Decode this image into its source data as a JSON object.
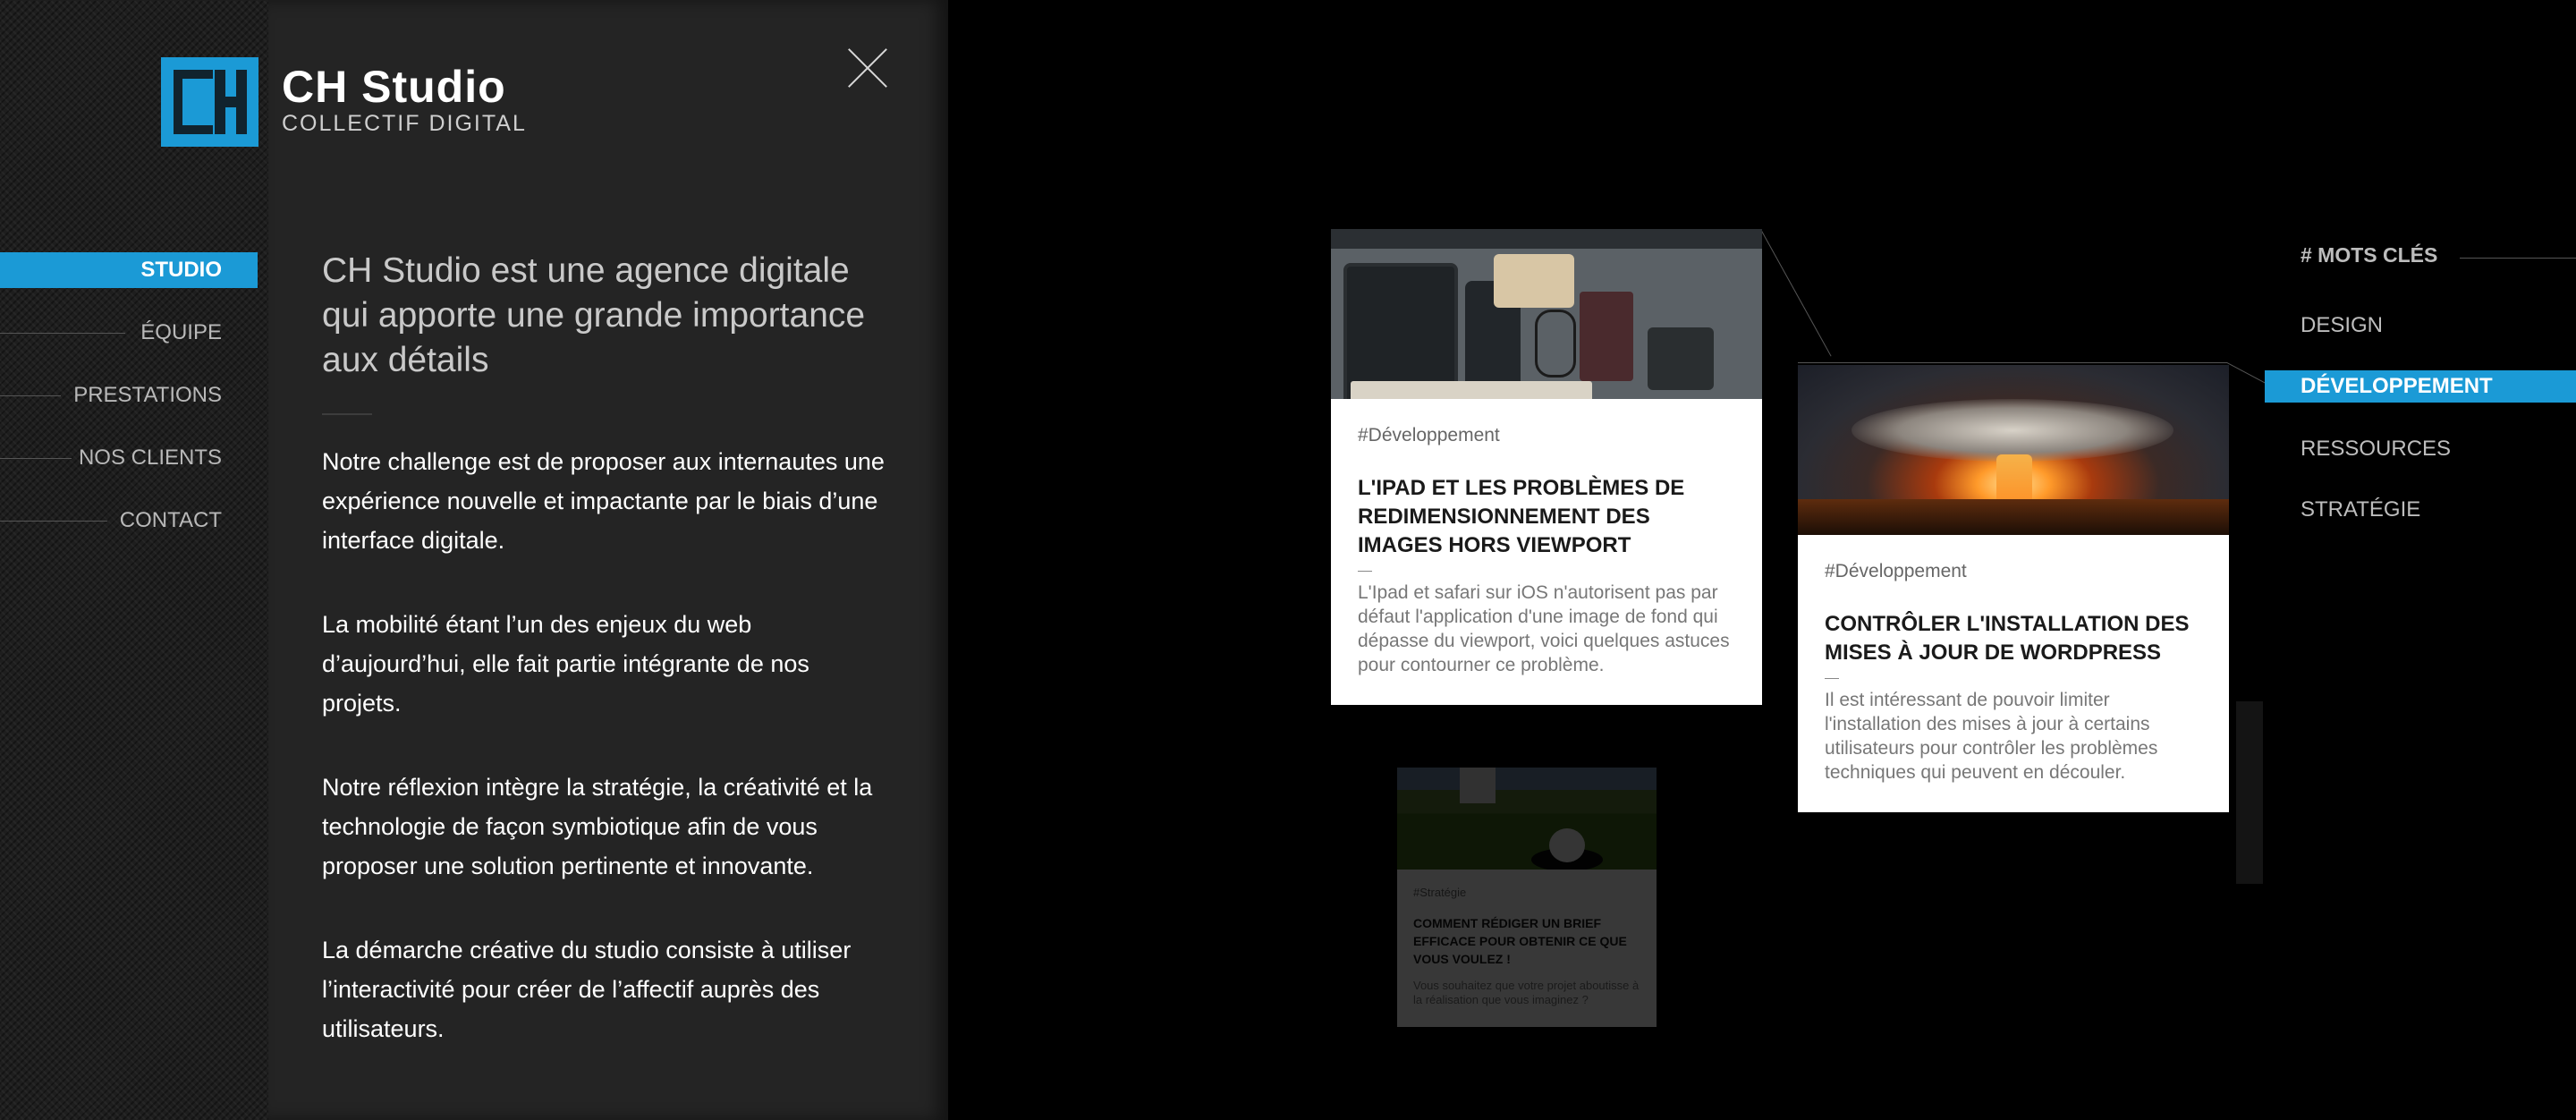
{
  "brand": {
    "name": "CH Studio",
    "tagline": "COLLECTIF DIGITAL"
  },
  "left_nav": [
    {
      "label": "STUDIO",
      "active": true
    },
    {
      "label": "ÉQUIPE",
      "active": false
    },
    {
      "label": "PRESTATIONS",
      "active": false
    },
    {
      "label": "NOS CLIENTS",
      "active": false
    },
    {
      "label": "CONTACT",
      "active": false
    }
  ],
  "panel": {
    "intro": "CH Studio est une agence digitale qui apporte une grande importance aux détails",
    "paragraphs": [
      "Notre challenge est de proposer aux internautes une expérience nouvelle et impactante par le biais d’une interface digitale.",
      "La mobilité étant l’un des enjeux du web d’aujourd’hui, elle fait partie intégrante de nos projets.",
      "Notre réflexion intègre la stratégie, la créativité et la technologie de façon symbiotique afin de vous proposer une solution pertinente et innovante.",
      "La démarche créative du studio consiste à utiliser l’interactivité pour créer de l’affectif auprès des utilisateurs."
    ]
  },
  "cards": [
    {
      "tag": "#Développement",
      "title": "L'IPAD ET LES PROBLÈMES DE REDIMENSIONNEMENT DES IMAGES HORS VIEWPORT",
      "excerpt": "L'Ipad et safari sur iOS n'autorisent pas par défaut l'application d'une image de fond qui dépasse du viewport, voici quelques astuces pour contourner ce problème."
    },
    {
      "tag": "#Développement",
      "title": "CONTRÔLER L'INSTALLATION DES MISES À JOUR DE WORDPRESS",
      "excerpt": "Il est intéressant de pouvoir limiter l'installation des mises à jour à certains utilisateurs pour contrôler les problèmes techniques qui peuvent en découler."
    },
    {
      "tag": "#Stratégie",
      "title": "COMMENT RÉDIGER UN BRIEF EFFICACE POUR OBTENIR CE QUE VOUS VOULEZ !",
      "excerpt": "Vous souhaitez que votre projet aboutisse à la réalisation que vous imaginez ?"
    }
  ],
  "keywords": {
    "title": "# MOTS CLÉS",
    "items": [
      {
        "label": "DESIGN",
        "active": false
      },
      {
        "label": "DÉVELOPPEMENT",
        "active": true
      },
      {
        "label": "RESSOURCES",
        "active": false
      },
      {
        "label": "STRATÉGIE",
        "active": false
      }
    ]
  },
  "colors": {
    "accent": "#1b9ad6",
    "panel": "#242424",
    "background": "#000000"
  }
}
